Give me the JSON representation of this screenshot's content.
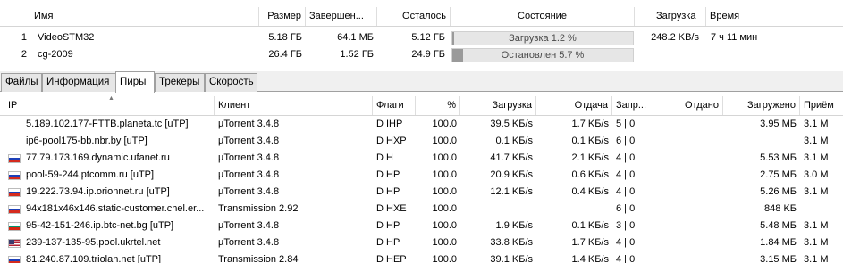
{
  "torrents": {
    "columns": [
      "Имя",
      "Размер",
      "Завершен...",
      "Осталось",
      "Состояние",
      "Загрузка",
      "Время"
    ],
    "rows": [
      {
        "num": "1",
        "name": "VideoSTM32",
        "size": "5.18 ГБ",
        "done": "64.1 МБ",
        "remaining": "5.12 ГБ",
        "status": "Загрузка 1.2 %",
        "progress": 0.012,
        "download": "248.2 KB/s",
        "time": "7 ч 11 мин"
      },
      {
        "num": "2",
        "name": "cg-2009",
        "size": "26.4 ГБ",
        "done": "1.52 ГБ",
        "remaining": "24.9 ГБ",
        "status": "Остановлен 5.7 %",
        "progress": 0.057,
        "download": "",
        "time": ""
      }
    ]
  },
  "tabs": [
    {
      "label": "Файлы",
      "active": false
    },
    {
      "label": "Информация",
      "active": false
    },
    {
      "label": "Пиры",
      "active": true
    },
    {
      "label": "Трекеры",
      "active": false
    },
    {
      "label": "Скорость",
      "active": false
    }
  ],
  "peers": {
    "columns": [
      "IP",
      "Клиент",
      "Флаги",
      "%",
      "Загрузка",
      "Отдача",
      "Запр...",
      "Отдано",
      "Загружено",
      "Приём"
    ],
    "rows": [
      {
        "flag": "none",
        "ip": "5.189.102.177-FTTB.planeta.tc [uTP]",
        "client": "µTorrent 3.4.8",
        "flags": "D IHP",
        "pct": "100.0",
        "down": "39.5 KБ/s",
        "up": "1.7 KБ/s",
        "req": "5 | 0",
        "sent": "",
        "recv": "3.95 МБ",
        "rate": "3.1 M"
      },
      {
        "flag": "none",
        "ip": "ip6-pool175-bb.nbr.by [uTP]",
        "client": "µTorrent 3.4.8",
        "flags": "D HXP",
        "pct": "100.0",
        "down": "0.1 KБ/s",
        "up": "0.1 KБ/s",
        "req": "6 | 0",
        "sent": "",
        "recv": "",
        "rate": "3.1 M"
      },
      {
        "flag": "ru",
        "ip": "77.79.173.169.dynamic.ufanet.ru",
        "client": "µTorrent 3.4.8",
        "flags": "D H",
        "pct": "100.0",
        "down": "41.7 KБ/s",
        "up": "2.1 KБ/s",
        "req": "4 | 0",
        "sent": "",
        "recv": "5.53 МБ",
        "rate": "3.1 M"
      },
      {
        "flag": "ru",
        "ip": "pool-59-244.ptcomm.ru [uTP]",
        "client": "µTorrent 3.4.8",
        "flags": "D HP",
        "pct": "100.0",
        "down": "20.9 KБ/s",
        "up": "0.6 KБ/s",
        "req": "4 | 0",
        "sent": "",
        "recv": "2.75 МБ",
        "rate": "3.0 M"
      },
      {
        "flag": "ru",
        "ip": "19.222.73.94.ip.orionnet.ru [uTP]",
        "client": "µTorrent 3.4.8",
        "flags": "D HP",
        "pct": "100.0",
        "down": "12.1 KБ/s",
        "up": "0.4 KБ/s",
        "req": "4 | 0",
        "sent": "",
        "recv": "5.26 МБ",
        "rate": "3.1 M"
      },
      {
        "flag": "ru",
        "ip": "94x181x46x146.static-customer.chel.er...",
        "client": "Transmission 2.92",
        "flags": "D HXE",
        "pct": "100.0",
        "down": "",
        "up": "",
        "req": "6 | 0",
        "sent": "",
        "recv": "848 KБ",
        "rate": ""
      },
      {
        "flag": "bg",
        "ip": "95-42-151-246.ip.btc-net.bg [uTP]",
        "client": "µTorrent 3.4.8",
        "flags": "D HP",
        "pct": "100.0",
        "down": "1.9 KБ/s",
        "up": "0.1 KБ/s",
        "req": "3 | 0",
        "sent": "",
        "recv": "5.48 МБ",
        "rate": "3.1 M"
      },
      {
        "flag": "us",
        "ip": "239-137-135-95.pool.ukrtel.net",
        "client": "µTorrent 3.4.8",
        "flags": "D HP",
        "pct": "100.0",
        "down": "33.8 KБ/s",
        "up": "1.7 KБ/s",
        "req": "4 | 0",
        "sent": "",
        "recv": "1.84 МБ",
        "rate": "3.1 M"
      },
      {
        "flag": "ru",
        "ip": "81.240.87.109.triolan.net [uTP]",
        "client": "Transmission 2.84",
        "flags": "D HEP",
        "pct": "100.0",
        "down": "39.1 KБ/s",
        "up": "1.4 KБ/s",
        "req": "4 | 0",
        "sent": "",
        "recv": "3.15 МБ",
        "rate": "3.1 M"
      }
    ]
  },
  "colors": {
    "progress_fill": "#9a9a9a",
    "progress_bg": "#e6e6e6",
    "tab_border": "#a0a0a0"
  }
}
